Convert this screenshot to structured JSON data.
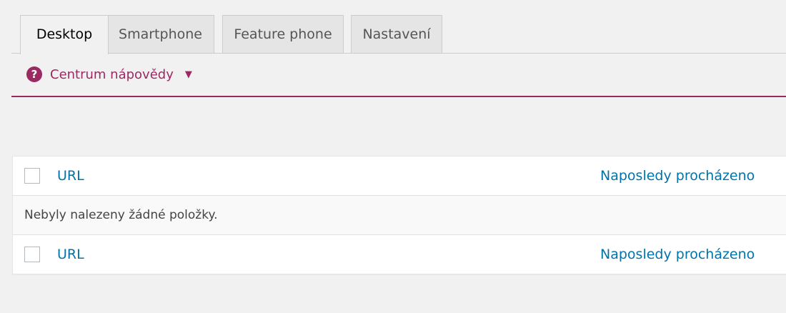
{
  "tabs": [
    {
      "label": "Desktop",
      "active": true
    },
    {
      "label": "Smartphone",
      "active": false
    },
    {
      "label": "Feature phone",
      "active": false
    },
    {
      "label": "Nastavení",
      "active": false
    }
  ],
  "help": {
    "icon_text": "?",
    "label": "Centrum nápovědy",
    "caret": "▼"
  },
  "table": {
    "columns": {
      "url": "URL",
      "last_crawled": "Naposledy procházeno"
    },
    "empty_message": "Nebyly nalezeny žádné položky."
  },
  "colors": {
    "accent": "#9b2a62",
    "link": "#0073aa"
  }
}
